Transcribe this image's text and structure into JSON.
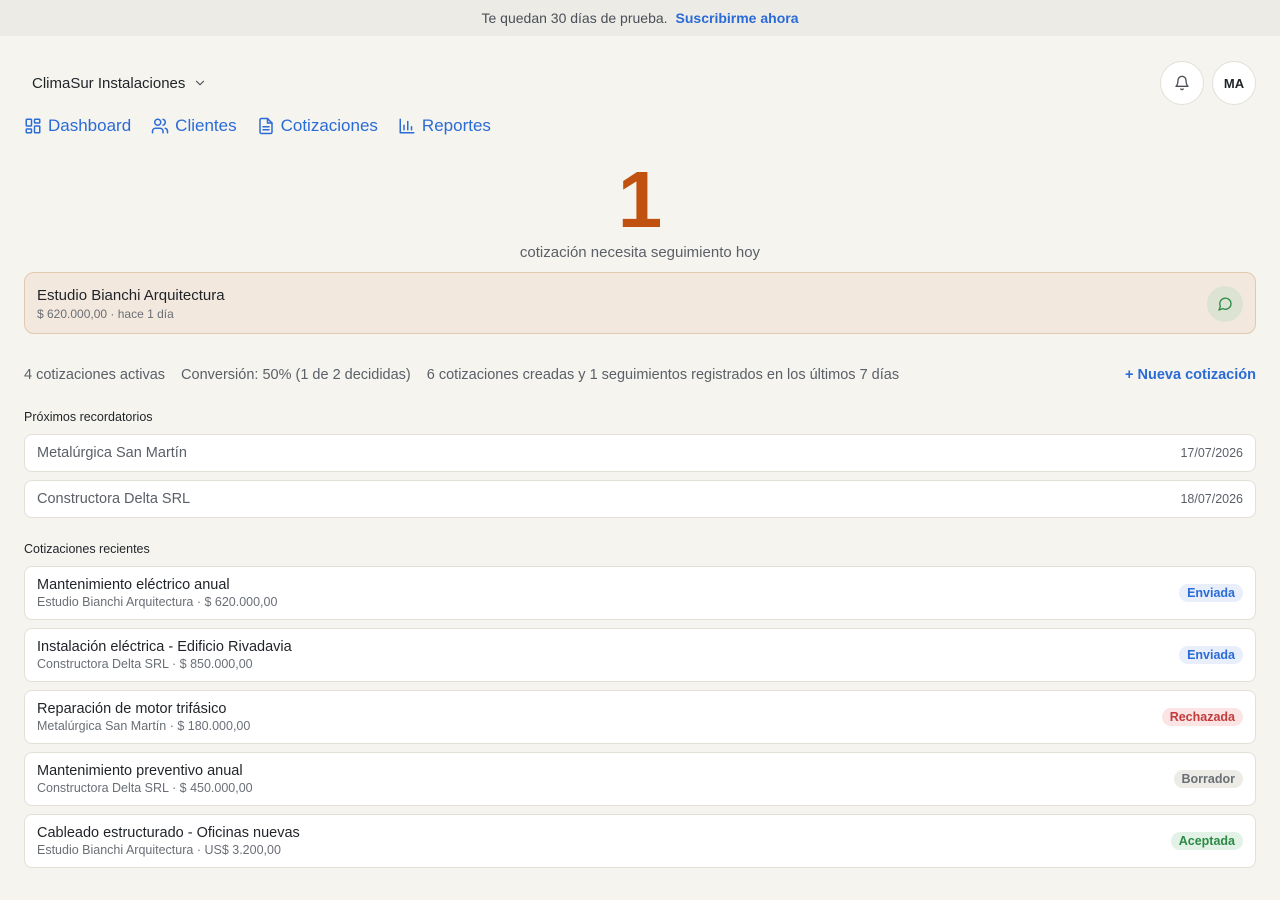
{
  "banner": {
    "text": "Te quedan 30 días de prueba.",
    "link": "Suscribirme ahora"
  },
  "header": {
    "company": "ClimaSur Instalaciones",
    "avatar_initials": "MA"
  },
  "nav": [
    {
      "label": "Dashboard",
      "icon": "dashboard-icon"
    },
    {
      "label": "Clientes",
      "icon": "users-icon"
    },
    {
      "label": "Cotizaciones",
      "icon": "document-icon"
    },
    {
      "label": "Reportes",
      "icon": "bar-chart-icon"
    }
  ],
  "hero": {
    "count": "1",
    "label": "cotización necesita seguimiento hoy"
  },
  "followup": {
    "client": "Estudio Bianchi Arquitectura",
    "detail": "$ 620.000,00 · hace 1 día"
  },
  "stats": {
    "active": "4 cotizaciones activas",
    "conversion": "Conversión: 50% (1 de 2 decididas)",
    "weekly": "6 cotizaciones creadas y 1 seguimientos registrados en los últimos 7 días",
    "new_quote": "+ Nueva cotización"
  },
  "reminders": {
    "title": "Próximos recordatorios",
    "items": [
      {
        "client": "Metalúrgica San Martín",
        "date": "17/07/2026"
      },
      {
        "client": "Constructora Delta SRL",
        "date": "18/07/2026"
      }
    ]
  },
  "recent": {
    "title": "Cotizaciones recientes",
    "items": [
      {
        "title": "Mantenimiento eléctrico anual",
        "sub": "Estudio Bianchi Arquitectura · $ 620.000,00",
        "status": "Enviada"
      },
      {
        "title": "Instalación eléctrica - Edificio Rivadavia",
        "sub": "Constructora Delta SRL · $ 850.000,00",
        "status": "Enviada"
      },
      {
        "title": "Reparación de motor trifásico",
        "sub": "Metalúrgica San Martín · $ 180.000,00",
        "status": "Rechazada"
      },
      {
        "title": "Mantenimiento preventivo anual",
        "sub": "Constructora Delta SRL · $ 450.000,00",
        "status": "Borrador"
      },
      {
        "title": "Cableado estructurado - Oficinas nuevas",
        "sub": "Estudio Bianchi Arquitectura · US$ 3.200,00",
        "status": "Aceptada"
      }
    ]
  },
  "colors": {
    "accent": "#2b6bd6",
    "hero": "#c0510e",
    "background": "#f5f4ef"
  }
}
